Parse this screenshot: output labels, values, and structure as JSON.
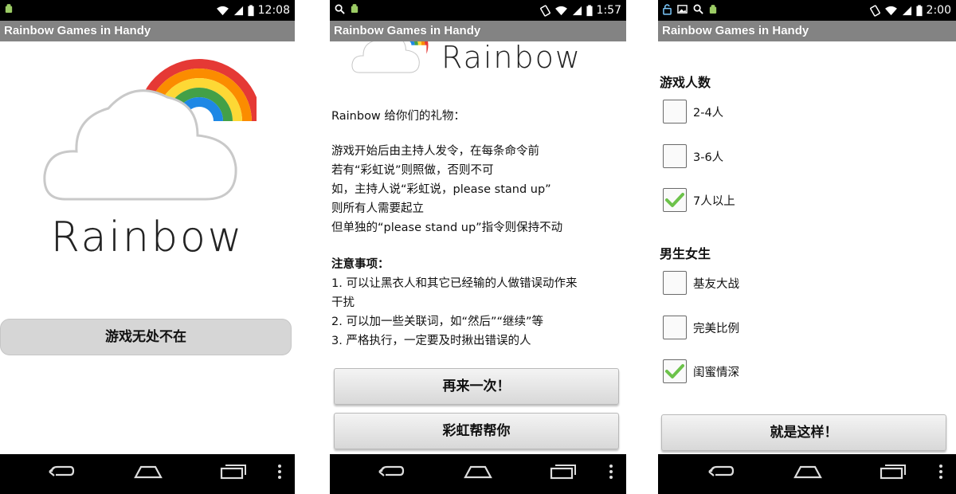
{
  "colors": {
    "statusbar": "#000000",
    "titlebar": "#838383",
    "button_bg": "#d6d6d6",
    "check_green": "#6cc24a",
    "rainbow": [
      "#e53935",
      "#fb8c00",
      "#fdd835",
      "#43a047",
      "#1e88e5"
    ]
  },
  "screens": [
    {
      "status": {
        "time": "12:08",
        "left_icons": [
          "android-icon"
        ],
        "right_icons": [
          "wifi-icon",
          "signal-icon",
          "battery-icon"
        ]
      },
      "title": "Rainbow Games in Handy",
      "logo": {
        "wordmark": "Rainbow"
      },
      "button": "游戏无处不在"
    },
    {
      "status": {
        "time": "1:57",
        "left_icons": [
          "search-icon",
          "android-icon"
        ],
        "right_icons": [
          "rotate-icon",
          "wifi-icon",
          "signal-icon",
          "battery-icon"
        ]
      },
      "title": "Rainbow Games in Handy",
      "logo": {
        "wordmark": "Rainbow"
      },
      "gift_title": "Rainbow 给你们的礼物：",
      "rules": [
        "游戏开始后由主持人发令，在每条命令前",
        "若有“彩虹说”则照做，否则不可",
        "如，主持人说“彩虹说，please stand up”",
        "则所有人需要起立",
        "但单独的“please stand up”指令则保持不动"
      ],
      "notes_title": "注意事项：",
      "notes": [
        "1.  可以让黑衣人和其它已经输的人做错误动作来",
        "干扰",
        "2.  可以加一些关联词，如“然后”“继续”等",
        "3.  严格执行，一定要及时揪出错误的人"
      ],
      "buttons": [
        "再来一次！",
        "彩虹帮帮你"
      ]
    },
    {
      "status": {
        "time": "2:00",
        "left_icons": [
          "lock-icon",
          "image-icon",
          "search-icon",
          "android-icon"
        ],
        "right_icons": [
          "rotate-icon",
          "wifi-icon",
          "signal-icon",
          "battery-icon"
        ]
      },
      "title": "Rainbow Games in Handy",
      "sections": [
        {
          "heading": "游戏人数",
          "options": [
            {
              "label": "2-4人",
              "checked": false
            },
            {
              "label": "3-6人",
              "checked": false
            },
            {
              "label": "7人以上",
              "checked": true
            }
          ]
        },
        {
          "heading": "男生女生",
          "options": [
            {
              "label": "基友大战",
              "checked": false
            },
            {
              "label": "完美比例",
              "checked": false
            },
            {
              "label": "闺蜜情深",
              "checked": true
            }
          ]
        }
      ],
      "button": "就是这样！"
    }
  ],
  "navbar": {
    "icons": [
      "back-icon",
      "home-icon",
      "recent-apps-icon",
      "menu-icon"
    ]
  }
}
